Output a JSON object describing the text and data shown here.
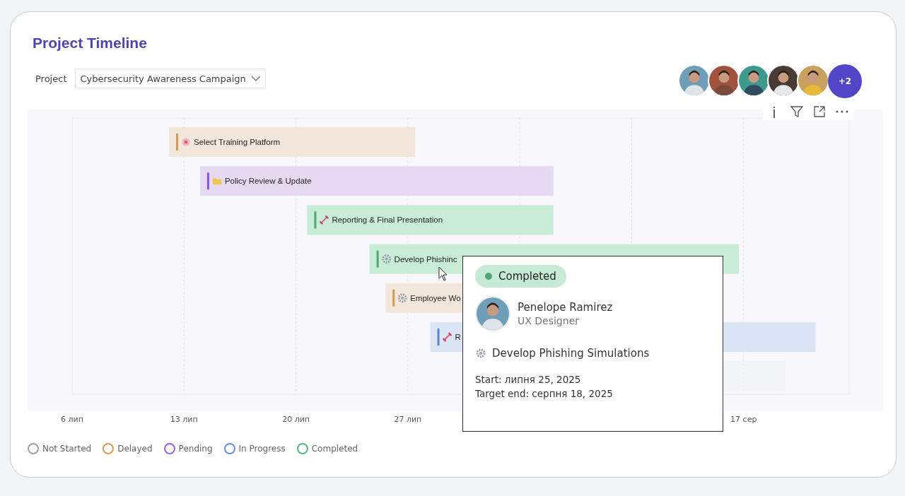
{
  "title": "Project Timeline",
  "project": {
    "label": "Project",
    "value": "Cybersecurity Awareness Campaign"
  },
  "team": {
    "more": "+2"
  },
  "tasks": [
    {
      "label": "Select Training Platform",
      "kind": "delayed"
    },
    {
      "label": "Policy Review & Update",
      "kind": "pending"
    },
    {
      "label": "Reporting & Final Presentation",
      "kind": "completed"
    },
    {
      "label": "Develop Phishinc",
      "kind": "completed"
    },
    {
      "label": "Employee Wo",
      "kind": "delayed"
    },
    {
      "label": "R",
      "kind": "in_progress"
    },
    {
      "kind": "not_started"
    }
  ],
  "timeline_axis": [
    "6 лип",
    "13 лип",
    "20 лип",
    "27 лип",
    "17 сер"
  ],
  "legend": [
    {
      "label": "Not Started",
      "color": "#a0a0a0"
    },
    {
      "label": "Delayed",
      "color": "#d39a55"
    },
    {
      "label": "Pending",
      "color": "#9466d8"
    },
    {
      "label": "In Progress",
      "color": "#6a8fd8"
    },
    {
      "label": "Completed",
      "color": "#5bb57f"
    }
  ],
  "tooltip": {
    "status": "Completed",
    "person": {
      "name": "Penelope Ramirez",
      "role": "UX Designer"
    },
    "task": "Develop Phishing Simulations",
    "start": "Start: липня 25, 2025",
    "end": "Target end: серпня 18, 2025"
  }
}
